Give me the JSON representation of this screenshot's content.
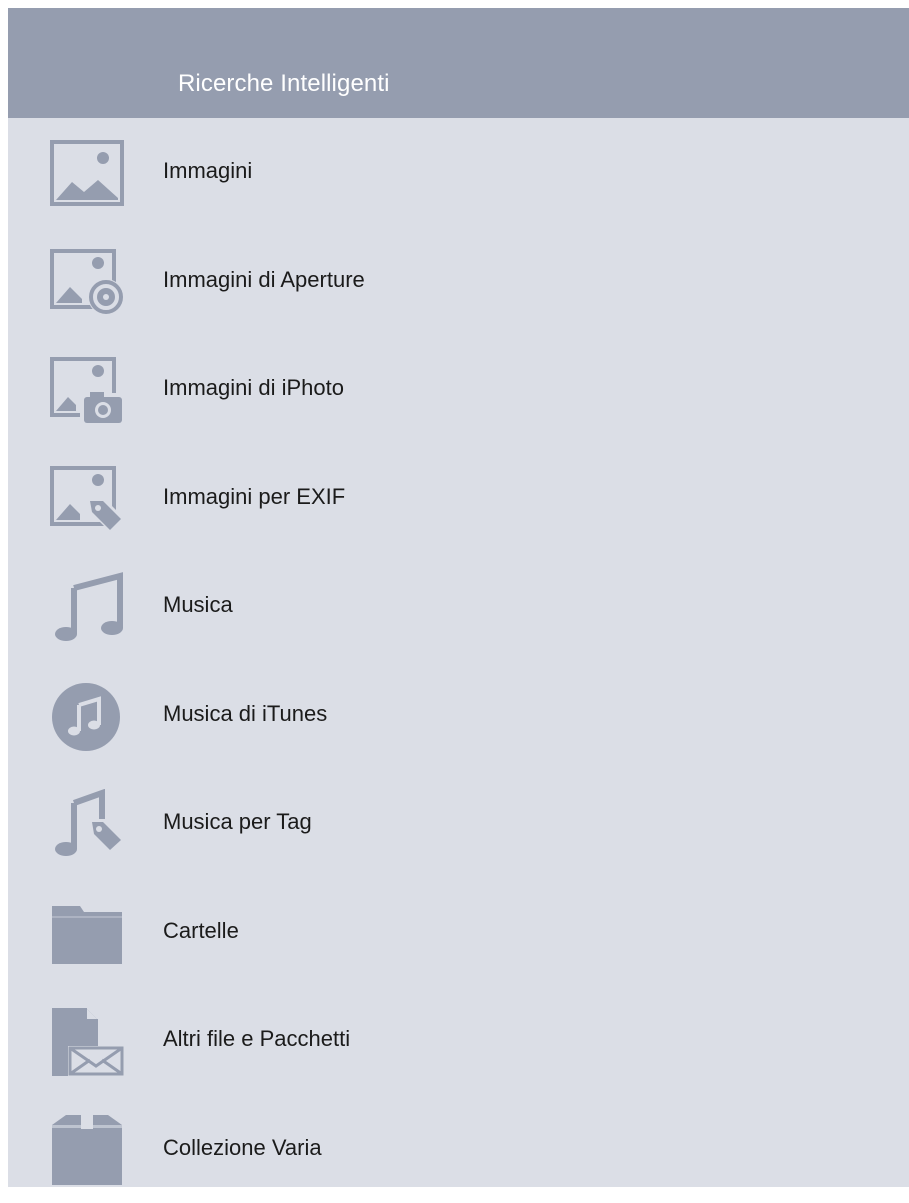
{
  "header": {
    "title": "Ricerche Intelligenti"
  },
  "colors": {
    "header_bg": "#959daf",
    "panel_bg": "#dbdee6",
    "icon": "#959daf"
  },
  "items": [
    {
      "label": "Immagini",
      "icon": "image-icon"
    },
    {
      "label": "Immagini di Aperture",
      "icon": "aperture-image-icon"
    },
    {
      "label": "Immagini di iPhoto",
      "icon": "iphoto-image-icon"
    },
    {
      "label": "Immagini per EXIF",
      "icon": "exif-image-icon"
    },
    {
      "label": "Musica",
      "icon": "music-note-icon"
    },
    {
      "label": "Musica di iTunes",
      "icon": "itunes-music-icon"
    },
    {
      "label": "Musica per Tag",
      "icon": "music-tag-icon"
    },
    {
      "label": "Cartelle",
      "icon": "folder-icon"
    },
    {
      "label": "Altri file e Pacchetti",
      "icon": "file-package-icon"
    },
    {
      "label": "Collezione Varia",
      "icon": "box-collection-icon"
    }
  ]
}
